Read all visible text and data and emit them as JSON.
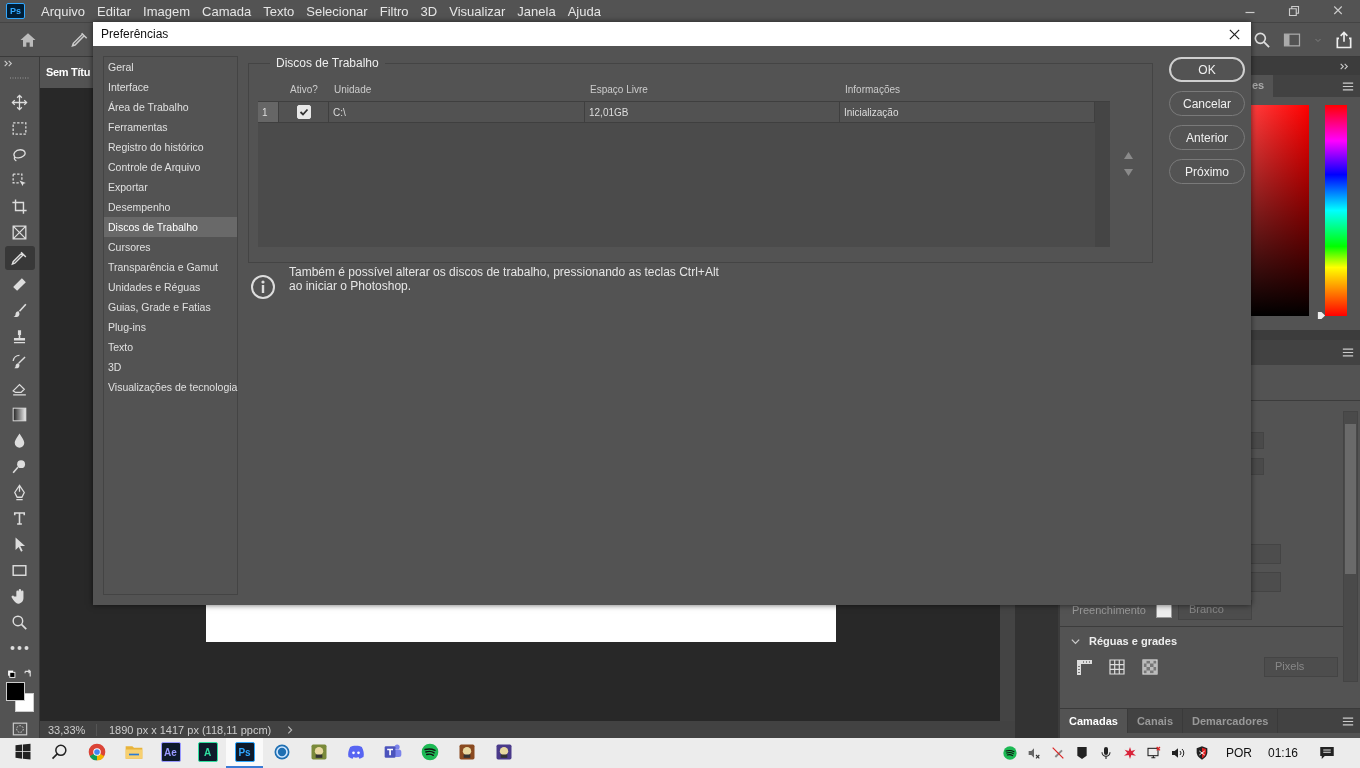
{
  "menu_bar": {
    "logo": "Ps",
    "items": [
      "Arquivo",
      "Editar",
      "Imagem",
      "Camada",
      "Texto",
      "Selecionar",
      "Filtro",
      "3D",
      "Visualizar",
      "Janela",
      "Ajuda"
    ]
  },
  "tools": [
    {
      "kind": "move",
      "selected": false
    },
    {
      "kind": "marquee",
      "selected": false
    },
    {
      "kind": "lasso",
      "selected": false
    },
    {
      "kind": "object-select",
      "selected": false
    },
    {
      "kind": "crop",
      "selected": false
    },
    {
      "kind": "frame",
      "selected": false
    },
    {
      "kind": "eyedropper",
      "selected": true
    },
    {
      "kind": "healing",
      "selected": false
    },
    {
      "kind": "brush",
      "selected": false
    },
    {
      "kind": "stamp",
      "selected": false
    },
    {
      "kind": "history-brush",
      "selected": false
    },
    {
      "kind": "eraser",
      "selected": false
    },
    {
      "kind": "gradient",
      "selected": false
    },
    {
      "kind": "blur",
      "selected": false
    },
    {
      "kind": "dodge",
      "selected": false
    },
    {
      "kind": "pen",
      "selected": false
    },
    {
      "kind": "type",
      "selected": false
    },
    {
      "kind": "path-select",
      "selected": false
    },
    {
      "kind": "rectangle",
      "selected": false
    },
    {
      "kind": "hand",
      "selected": false
    },
    {
      "kind": "zoom",
      "selected": false
    },
    {
      "kind": "more",
      "selected": false
    }
  ],
  "document": {
    "tab": "Sem Títu",
    "zoom": "33,33%",
    "info": "1890 px x 1417 px (118,11 ppcm)"
  },
  "color_panel": {
    "tab": "es",
    "hue_slider": {
      "level": 0
    }
  },
  "properties": {
    "fill_label": "Preenchimento",
    "fill_value": "Branco",
    "section": "Réguas e grades",
    "units": "Pixels"
  },
  "bottom_tabs": [
    {
      "label": "Camadas",
      "selected": true
    },
    {
      "label": "Canais",
      "selected": false
    },
    {
      "label": "Demarcadores",
      "selected": false
    }
  ],
  "dialog": {
    "title": "Preferências",
    "categories": [
      {
        "label": "Geral",
        "selected": false
      },
      {
        "label": "Interface",
        "selected": false
      },
      {
        "label": "Área de Trabalho",
        "selected": false
      },
      {
        "label": "Ferramentas",
        "selected": false
      },
      {
        "label": "Registro do histórico",
        "selected": false
      },
      {
        "label": "Controle de Arquivo",
        "selected": false
      },
      {
        "label": "Exportar",
        "selected": false
      },
      {
        "label": "Desempenho",
        "selected": false
      },
      {
        "label": "Discos de Trabalho",
        "selected": true
      },
      {
        "label": "Cursores",
        "selected": false
      },
      {
        "label": "Transparência e Gamut",
        "selected": false
      },
      {
        "label": "Unidades e Réguas",
        "selected": false
      },
      {
        "label": "Guias, Grade e Fatias",
        "selected": false
      },
      {
        "label": "Plug-ins",
        "selected": false
      },
      {
        "label": "Texto",
        "selected": false
      },
      {
        "label": "3D",
        "selected": false
      },
      {
        "label": "Visualizações de tecnologia",
        "selected": false
      }
    ],
    "group_title": "Discos de Trabalho",
    "table": {
      "columns": [
        "Ativo?",
        "Unidade",
        "Espaço Livre",
        "Informações"
      ],
      "rows": [
        {
          "index": "1",
          "active": true,
          "drive": "C:\\",
          "free": "12,01GB",
          "info": "Inicialização"
        }
      ]
    },
    "info_lines": [
      "Também é possível alterar os discos de trabalho, pressionando as teclas Ctrl+Alt",
      "ao iniciar o Photoshop."
    ],
    "buttons": [
      {
        "label": "OK",
        "default": true
      },
      {
        "label": "Cancelar",
        "default": false
      },
      {
        "label": "Anterior",
        "default": false
      },
      {
        "label": "Próximo",
        "default": false
      }
    ]
  },
  "taskbar": {
    "apps": [
      {
        "kind": "windows",
        "selected": false
      },
      {
        "kind": "search",
        "selected": false
      },
      {
        "kind": "chrome",
        "selected": false
      },
      {
        "kind": "folder",
        "selected": false
      },
      {
        "kind": "tile",
        "label": "Ae",
        "color": "#9999ff",
        "selected": false
      },
      {
        "kind": "tile",
        "label": "A",
        "color": "#2fe0a0",
        "selected": false
      },
      {
        "kind": "tile",
        "label": "Ps",
        "color": "#31a8ff",
        "selected": true
      },
      {
        "kind": "ring",
        "selected": false
      },
      {
        "kind": "game",
        "color": "#7a8a3a",
        "selected": false
      },
      {
        "kind": "discord",
        "selected": false
      },
      {
        "kind": "teams",
        "selected": false
      },
      {
        "kind": "spotify",
        "selected": false
      },
      {
        "kind": "game",
        "color": "#8a4a20",
        "selected": false
      },
      {
        "kind": "game",
        "color": "#4a3a8a",
        "selected": false
      }
    ],
    "tray": [
      {
        "kind": "spotify"
      },
      {
        "kind": "muted"
      },
      {
        "kind": "crossed"
      },
      {
        "kind": "shield-dark"
      },
      {
        "kind": "mic"
      },
      {
        "kind": "star"
      },
      {
        "kind": "network"
      },
      {
        "kind": "volume"
      },
      {
        "kind": "shield-red"
      }
    ],
    "language": "POR",
    "time": "01:16"
  }
}
